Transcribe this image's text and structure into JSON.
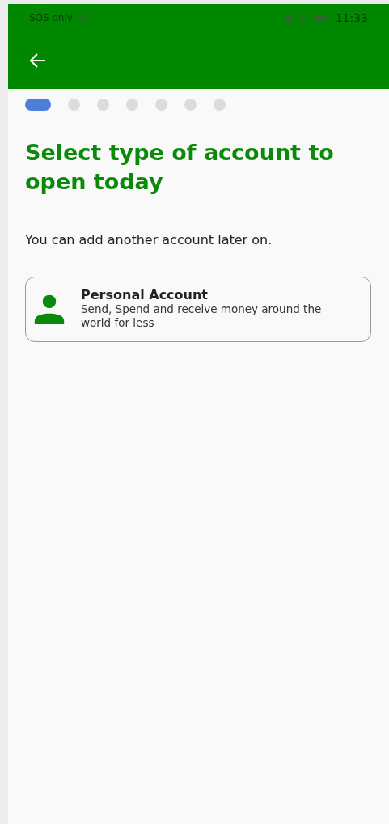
{
  "status_bar": {
    "carrier": "SOS only",
    "time": "11:33"
  },
  "steps": [
    {
      "selected": true
    },
    {
      "selected": false
    },
    {
      "selected": false
    },
    {
      "selected": false
    },
    {
      "selected": false
    },
    {
      "selected": false
    },
    {
      "selected": false
    }
  ],
  "title": "Select type of account to open today",
  "subtitle": "You can add another account later on.",
  "options": [
    {
      "title": "Personal Account",
      "description": "Send, Spend and receive money around the world for less",
      "selected": false
    }
  ]
}
